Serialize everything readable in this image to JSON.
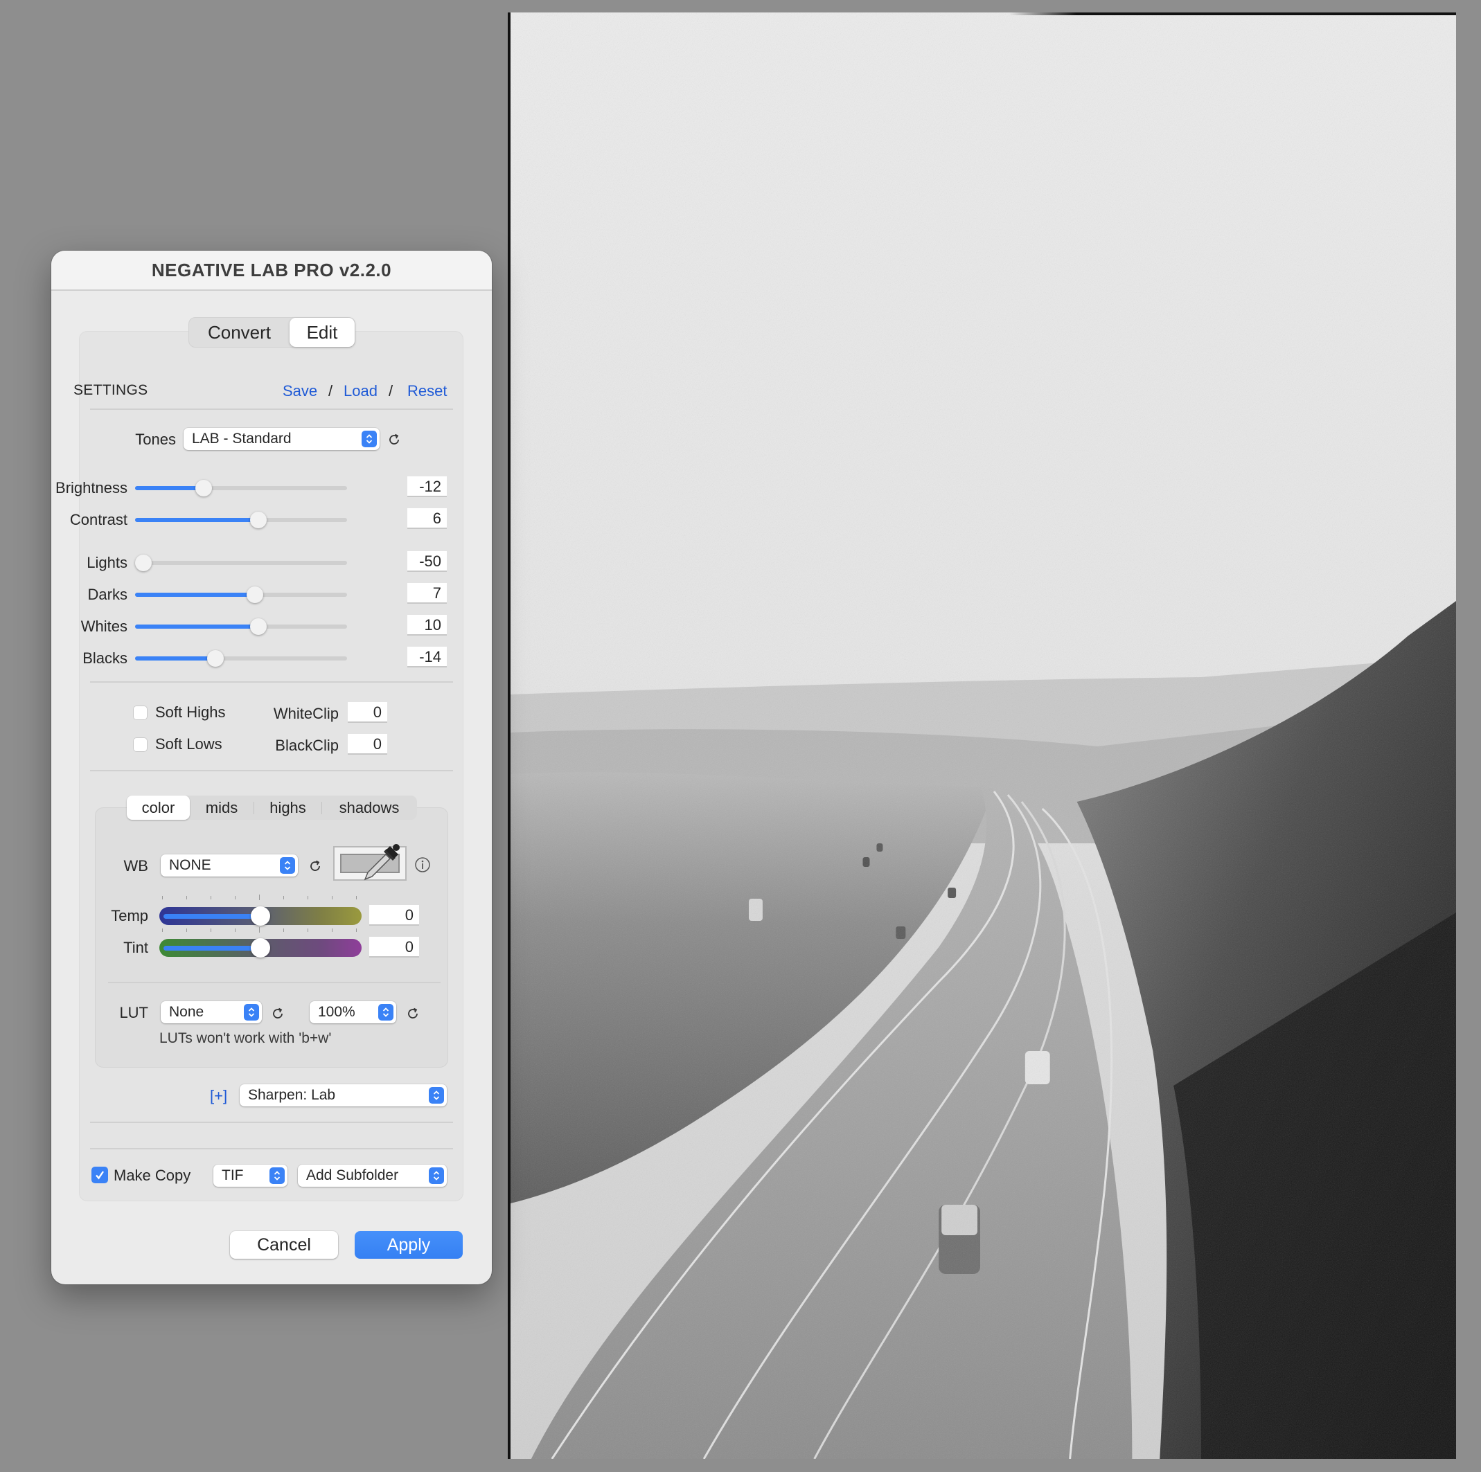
{
  "window": {
    "title": "NEGATIVE LAB PRO v2.2.0"
  },
  "mode_tabs": [
    {
      "label": "Convert",
      "active": false
    },
    {
      "label": "Edit",
      "active": true
    }
  ],
  "settings": {
    "heading": "SETTINGS",
    "save_label": "Save",
    "load_label": "Load",
    "reset_label": "Reset",
    "separator": "/"
  },
  "tones": {
    "label": "Tones",
    "value": "LAB - Standard"
  },
  "sliders": [
    {
      "label": "Brightness",
      "value": "-12",
      "fill_fraction": 0.31
    },
    {
      "label": "Contrast",
      "value": "6",
      "fill_fraction": 0.59
    },
    {
      "label": "Lights",
      "value": "-50",
      "fill_fraction": 0.0
    },
    {
      "label": "Darks",
      "value": "7",
      "fill_fraction": 0.57
    },
    {
      "label": "Whites",
      "value": "10",
      "fill_fraction": 0.59
    },
    {
      "label": "Blacks",
      "value": "-14",
      "fill_fraction": 0.37
    }
  ],
  "soft_options": [
    {
      "label": "Soft Highs",
      "checked": false,
      "clip_label": "WhiteClip",
      "clip_value": "0"
    },
    {
      "label": "Soft Lows",
      "checked": false,
      "clip_label": "BlackClip",
      "clip_value": "0"
    }
  ],
  "sub_tabs": [
    {
      "label": "color",
      "active": true
    },
    {
      "label": "mids",
      "active": false
    },
    {
      "label": "highs",
      "active": false
    },
    {
      "label": "shadows",
      "active": false
    }
  ],
  "color_panel": {
    "wb_label": "WB",
    "wb_value": "NONE",
    "temp": {
      "label": "Temp",
      "value": "0",
      "position_fraction": 0.5
    },
    "tint": {
      "label": "Tint",
      "value": "0",
      "position_fraction": 0.5
    },
    "lut_label": "LUT",
    "lut_value": "None",
    "lut_strength": "100%",
    "lut_note": "LUTs won't work with 'b+w'"
  },
  "sharpen": {
    "expand_label": "[+]",
    "value": "Sharpen: Lab"
  },
  "output": {
    "make_copy_label": "Make Copy",
    "make_copy_checked": true,
    "format_value": "TIF",
    "subfolder_value": "Add Subfolder"
  },
  "buttons": {
    "cancel": "Cancel",
    "apply": "Apply"
  },
  "colors": {
    "accent": "#3a82f6",
    "link": "#1f5ad6",
    "background": "#8e8e8e"
  }
}
